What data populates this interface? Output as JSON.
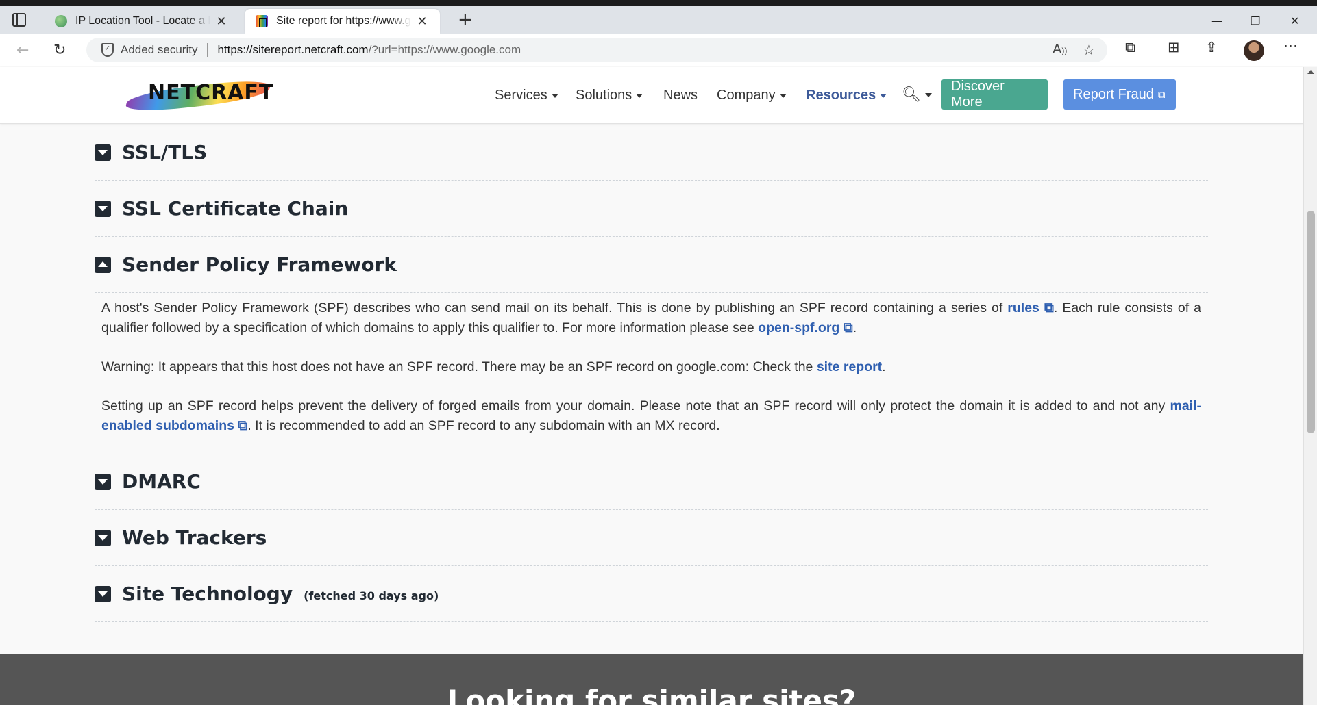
{
  "browser": {
    "tabs": [
      {
        "title": "IP Location Tool - Locate a Network",
        "active": false
      },
      {
        "title": "Site report for https://www.google.com",
        "active": true
      }
    ],
    "new_tab": "+",
    "window_controls": {
      "minimize": "—",
      "restore": "❐",
      "close": "✕"
    },
    "security_label": "Added security",
    "url_host": "https://sitereport.netcraft.com",
    "url_rest": "/?url=https://www.google.com"
  },
  "site": {
    "logo_text": "NETCRAFT",
    "nav": {
      "services": "Services",
      "solutions": "Solutions",
      "news": "News",
      "company": "Company",
      "resources": "Resources"
    },
    "discover_button": "Discover More",
    "report_button": "Report Fraud"
  },
  "sections": {
    "ssl_tls": "SSL/TLS",
    "ssl_chain": "SSL Certificate Chain",
    "spf": "Sender Policy Framework",
    "dmarc": "DMARC",
    "web_trackers": "Web Trackers",
    "site_technology": "Site Technology",
    "site_technology_note": "(fetched 30 days ago)"
  },
  "spf_content": {
    "p1_a": "A host's Sender Policy Framework (SPF) describes who can send mail on its behalf. This is done by publishing an SPF record containing a series of ",
    "p1_link1": "rules",
    "p1_b": ". Each rule consists of a qualifier followed by a specification of which domains to apply this qualifier to. For more information please see ",
    "p1_link2": "open-spf.org",
    "p1_c": ".",
    "p2_a": "Warning: It appears that this host does not have an SPF record. There may be an SPF record on google.com: Check the ",
    "p2_link": "site report",
    "p2_b": ".",
    "p3_a": "Setting up an SPF record helps prevent the delivery of forged emails from your domain. Please note that an SPF record will only protect the domain it is added to and not any ",
    "p3_link": "mail-enabled subdomains",
    "p3_b": ". It is recommended to add an SPF record to any subdomain with an MX record."
  },
  "footer": {
    "title": "Looking for similar sites?"
  },
  "colors": {
    "discover": "#4aa790",
    "report": "#5b8fe0",
    "link": "#2f5fb0",
    "resources_active": "#3d5a99",
    "footer_bg": "#555555"
  }
}
